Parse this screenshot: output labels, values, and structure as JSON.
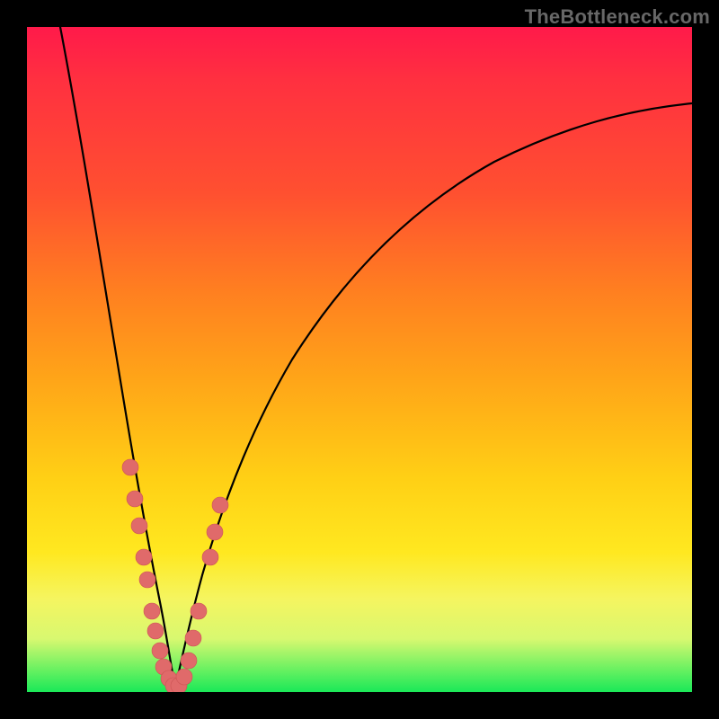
{
  "attribution": "TheBottleneck.com",
  "chart_data": {
    "type": "line",
    "title": "",
    "xlabel": "",
    "ylabel": "",
    "xlim": [
      0,
      100
    ],
    "ylim": [
      0,
      100
    ],
    "series": [
      {
        "name": "bottleneck-curve-left",
        "x": [
          5,
          7,
          9,
          11,
          13,
          15,
          16.5,
          18,
          19,
          20,
          21,
          22
        ],
        "y": [
          100,
          88,
          76,
          64,
          52,
          40,
          30,
          20,
          13,
          7,
          3,
          0
        ]
      },
      {
        "name": "bottleneck-curve-right",
        "x": [
          22,
          23.5,
          25,
          27,
          30,
          34,
          40,
          48,
          58,
          70,
          84,
          100
        ],
        "y": [
          0,
          4,
          10,
          18,
          28,
          40,
          52,
          63,
          72,
          79,
          84,
          88
        ]
      }
    ],
    "markers": {
      "name": "beads",
      "points": [
        {
          "x": 15.5,
          "y": 34
        },
        {
          "x": 16.2,
          "y": 29
        },
        {
          "x": 16.8,
          "y": 25
        },
        {
          "x": 17.5,
          "y": 20
        },
        {
          "x": 18.0,
          "y": 17
        },
        {
          "x": 18.7,
          "y": 12
        },
        {
          "x": 19.3,
          "y": 9
        },
        {
          "x": 20.0,
          "y": 6
        },
        {
          "x": 20.6,
          "y": 3.5
        },
        {
          "x": 21.3,
          "y": 1.5
        },
        {
          "x": 22.0,
          "y": 0.7
        },
        {
          "x": 22.8,
          "y": 0.7
        },
        {
          "x": 23.6,
          "y": 2
        },
        {
          "x": 24.3,
          "y": 4.5
        },
        {
          "x": 25.0,
          "y": 8
        },
        {
          "x": 25.8,
          "y": 12
        },
        {
          "x": 27.5,
          "y": 20
        },
        {
          "x": 28.3,
          "y": 24
        },
        {
          "x": 29.0,
          "y": 28
        }
      ]
    },
    "gradient_stops": [
      {
        "pos": 0,
        "color": "#ff1a4a"
      },
      {
        "pos": 25,
        "color": "#ff5030"
      },
      {
        "pos": 53,
        "color": "#ffa518"
      },
      {
        "pos": 79,
        "color": "#ffe820"
      },
      {
        "pos": 100,
        "color": "#1ae858"
      }
    ]
  }
}
